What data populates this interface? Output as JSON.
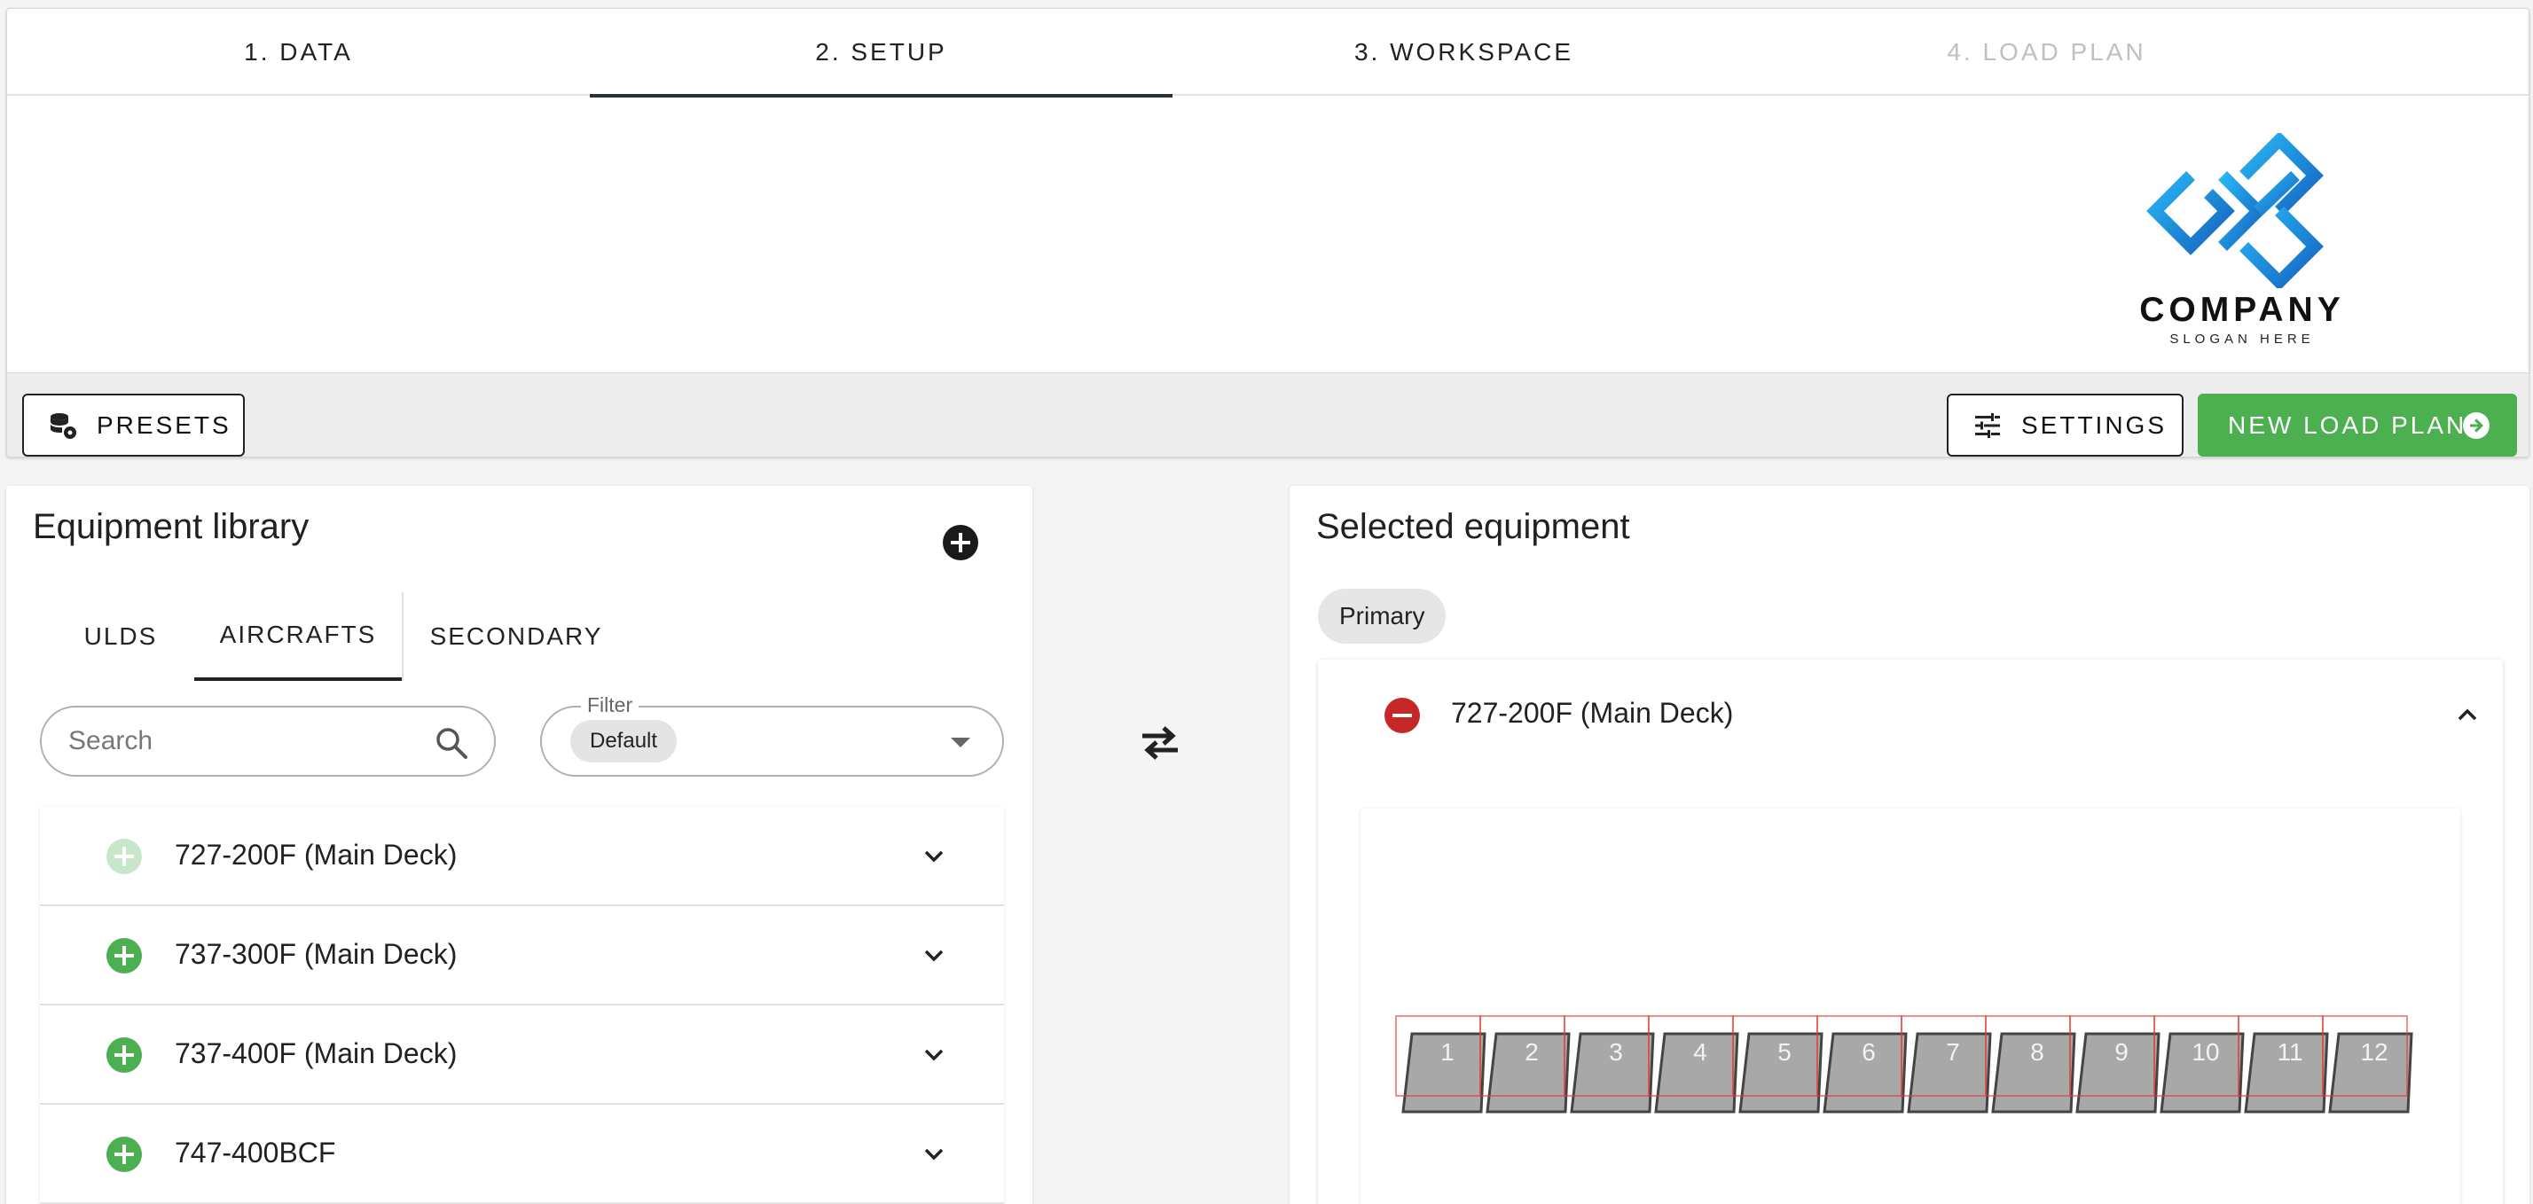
{
  "stepper": {
    "steps": [
      {
        "label": "1. DATA",
        "state": "done"
      },
      {
        "label": "2. SETUP",
        "state": "active"
      },
      {
        "label": "3. WORKSPACE",
        "state": "enabled"
      },
      {
        "label": "4. LOAD PLAN",
        "state": "disabled"
      }
    ]
  },
  "logo": {
    "company": "COMPANY",
    "slogan": "SLOGAN HERE",
    "colors": [
      "#1e88e5",
      "#29b6f6",
      "#1565c0"
    ]
  },
  "toolbar": {
    "presets_label": "PRESETS",
    "settings_label": "SETTINGS",
    "new_load_plan_label": "NEW LOAD PLAN",
    "accent_color": "#4caf50"
  },
  "library": {
    "title": "Equipment library",
    "tabs": [
      {
        "label": "ULDS",
        "active": false
      },
      {
        "label": "AIRCRAFTS",
        "active": true
      },
      {
        "label": "SECONDARY",
        "active": false
      }
    ],
    "search": {
      "placeholder": "Search",
      "value": ""
    },
    "filter": {
      "label": "Filter",
      "selected": "Default"
    },
    "items": [
      {
        "label": "727-200F (Main Deck)",
        "disabled": true
      },
      {
        "label": "737-300F (Main Deck)",
        "disabled": false
      },
      {
        "label": "737-400F (Main Deck)",
        "disabled": false
      },
      {
        "label": "747-400BCF",
        "disabled": false
      }
    ]
  },
  "selected": {
    "title": "Selected equipment",
    "group_chip": "Primary",
    "item": {
      "label": "727-200F (Main Deck)",
      "positions": [
        "1",
        "2",
        "3",
        "4",
        "5",
        "6",
        "7",
        "8",
        "9",
        "10",
        "11",
        "12"
      ]
    }
  },
  "icons": {
    "presets": "database-settings-icon",
    "settings": "tune-icon",
    "new_load_plan": "arrow-right-circle-icon",
    "add": "plus-circle-icon",
    "remove": "minus-circle-icon",
    "swap": "swap-horizontal-icon",
    "search": "magnify-icon",
    "expand": "chevron-down-icon",
    "collapse": "chevron-up-icon"
  },
  "colors": {
    "add_green": "#4caf50",
    "remove_red": "#c62828",
    "deck_fill": "#a8a8a8",
    "deck_outline": "#e53935"
  }
}
